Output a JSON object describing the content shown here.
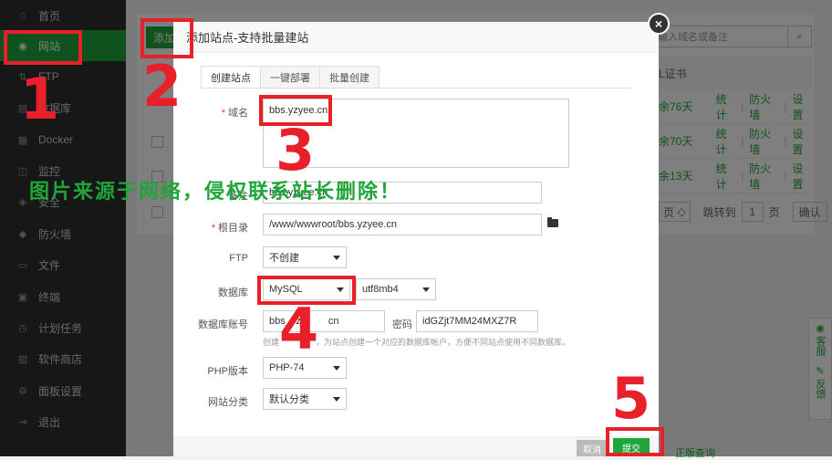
{
  "sidebar": {
    "items": [
      {
        "label": "首页",
        "icon": "home-icon",
        "glyph": "⌂"
      },
      {
        "label": "网站",
        "icon": "globe-icon",
        "glyph": "◉"
      },
      {
        "label": "FTP",
        "icon": "ftp-icon",
        "glyph": "⇅"
      },
      {
        "label": "数据库",
        "icon": "database-icon",
        "glyph": "▤"
      },
      {
        "label": "Docker",
        "icon": "docker-icon",
        "glyph": "▦"
      },
      {
        "label": "监控",
        "icon": "monitor-icon",
        "glyph": "◫"
      },
      {
        "label": "安全",
        "icon": "shield-icon",
        "glyph": "◈"
      },
      {
        "label": "防火墙",
        "icon": "firewall-icon",
        "glyph": "◆"
      },
      {
        "label": "文件",
        "icon": "folder-icon",
        "glyph": "▭"
      },
      {
        "label": "终端",
        "icon": "terminal-icon",
        "glyph": "▣"
      },
      {
        "label": "计划任务",
        "icon": "clock-icon",
        "glyph": "◷"
      },
      {
        "label": "软件商店",
        "icon": "store-icon",
        "glyph": "▥"
      },
      {
        "label": "面板设置",
        "icon": "gear-icon",
        "glyph": "⚙"
      },
      {
        "label": "退出",
        "icon": "logout-icon",
        "glyph": "⇥"
      }
    ]
  },
  "background": {
    "add_button": "添加",
    "search_placeholder": "输入域名或备注",
    "ssl_header": "L证书",
    "rows": [
      {
        "days": "余76天",
        "stats": "统计",
        "firewall": "防火墙",
        "settings": "设置"
      },
      {
        "days": "余70天",
        "stats": "统计",
        "firewall": "防火墙",
        "settings": "设置"
      },
      {
        "days": "余13天",
        "stats": "统计",
        "firewall": "防火墙",
        "settings": "设置"
      }
    ],
    "pager": {
      "per_page": "页",
      "jump_label": "跳转到",
      "page_value": "1",
      "page_unit": "页",
      "confirm": "确认"
    },
    "right_tabs": [
      "客服",
      "反馈"
    ],
    "bottom_link": "正版查询"
  },
  "modal": {
    "title": "添加站点-支持批量建站",
    "tabs": [
      "创建站点",
      "一键部署",
      "批量创建"
    ],
    "fields": {
      "domain_label": "域名",
      "domain_value": "bbs.yzyee.cn",
      "note_label": "备注",
      "note_value": "bbs.yzyee.cn",
      "root_label": "根目录",
      "root_value": "/www/wwwroot/bbs.yzyee.cn",
      "ftp_label": "FTP",
      "ftp_value": "不创建",
      "db_label": "数据库",
      "db_value": "MySQL",
      "db_charset": "utf8mb4",
      "db_account_label": "数据库账号",
      "db_account_value": "bbs_yz",
      "db_account_tail": "cn",
      "password_label": "密码",
      "password_value": "idGZjt7MM24MXZ7R",
      "hint": "创建",
      "hint_tail": "，为站点创建一个对应的数据库帐户，方便不同站点使用不同数据库。",
      "php_label": "PHP版本",
      "php_value": "PHP-74",
      "category_label": "网站分类",
      "category_value": "默认分类"
    },
    "cancel": "取消",
    "submit": "提交"
  },
  "annotations": {
    "numbers": [
      "1",
      "2",
      "3",
      "4",
      "5"
    ],
    "color": "#e8202a"
  },
  "watermark": "图片来源于网络，侵权联系站长删除！",
  "colors": {
    "accent": "#20a53a",
    "sidebar_bg": "#2f2f2f",
    "annotation_red": "#e8202a"
  }
}
